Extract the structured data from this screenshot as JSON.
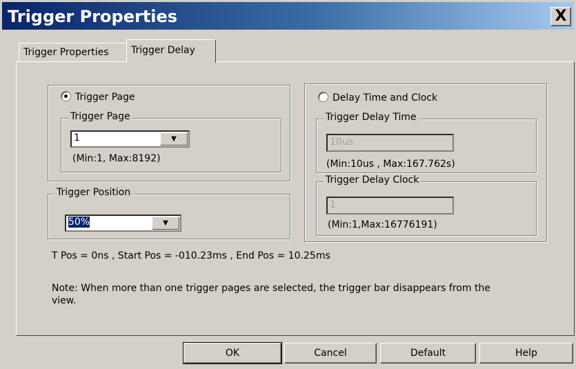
{
  "window": {
    "title": "Trigger Properties",
    "close_label": "X"
  },
  "tabs": [
    {
      "label": "Trigger Properties"
    },
    {
      "label": "Trigger Delay"
    }
  ],
  "trigger_page_group": {
    "radio_label": "Trigger Page",
    "inner_legend": "Trigger Page",
    "value": "1",
    "range": "(Min:1, Max:8192)"
  },
  "trigger_position_group": {
    "legend": "Trigger Position",
    "value": "50%"
  },
  "delay_group": {
    "radio_label": "Delay Time and Clock",
    "time_legend": "Trigger Delay Time",
    "time_value": "10us",
    "time_range": "(Min:10us , Max:167.762s)",
    "clock_legend": "Trigger Delay Clock",
    "clock_value": "1",
    "clock_range": "(Min:1,Max:16776191)"
  },
  "position_info": "T Pos = 0ns , Start Pos = -010.23ms , End Pos = 10.25ms",
  "note_line1": "Note: When more than one trigger pages are selected, the trigger bar disappears from the",
  "note_line2": "view.",
  "buttons": {
    "ok": "OK",
    "cancel": "Cancel",
    "default": "Default",
    "help": "Help"
  },
  "icons": {
    "dropdown": "chevron-down-icon",
    "close": "close-icon"
  }
}
